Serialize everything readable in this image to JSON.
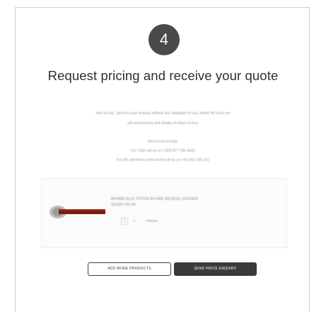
{
  "step": {
    "number": "4",
    "title": "Request pricing and receive your quote"
  },
  "intro": {
    "line1": "How to buy: Send us your enquiry without any obligation to buy, within 48 hours we",
    "line2": "will send pricing and details of where to buy."
  },
  "help": {
    "line1": "We're here to help.",
    "line2": "For USA call us on 1 800 877 296 4642",
    "line3": "For UK and Rest of the world call us on +44 (0)1 325 321"
  },
  "product": {
    "name_line1": "BONNEVILLE STITCH IN FIRE RECESS LEATHER",
    "name_line2": "SLEEK ON 1N",
    "qty_minus": "-",
    "qty_value": "1",
    "qty_plus": "+",
    "remove_label": "remove"
  },
  "buttons": {
    "add_more": "ADD MORE PRODUCTS",
    "send": "SEND PRICE ENQUIRY"
  },
  "colors": {
    "badge": "#4a4a4a",
    "send_button": "#3a3a3a",
    "leather": "#7a1f17"
  }
}
